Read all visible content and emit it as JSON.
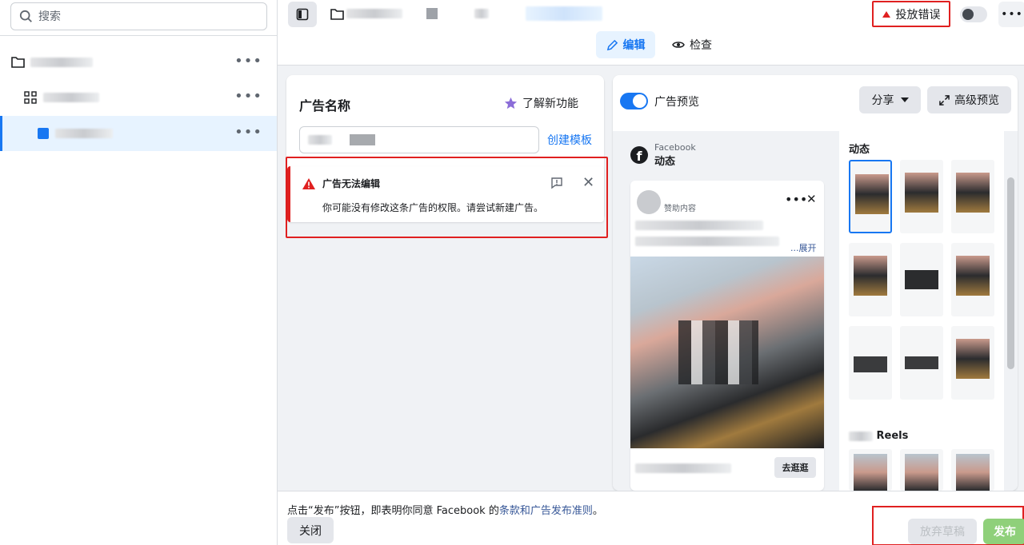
{
  "sidebar": {
    "search_placeholder": "搜索",
    "items": [
      {
        "type": "campaign"
      },
      {
        "type": "adset"
      },
      {
        "type": "ad",
        "selected": true
      }
    ]
  },
  "toolbar": {
    "error_label": "投放错误",
    "tab_edit": "编辑",
    "tab_check": "检查"
  },
  "editor": {
    "ad_name_label": "广告名称",
    "learn_features": "了解新功能",
    "create_template": "创建模板",
    "error_title": "广告无法编辑",
    "error_message": "你可能没有修改这条广告的权限。请尝试新建广告。"
  },
  "preview": {
    "toggle_label": "广告预览",
    "share_label": "分享",
    "advanced_label": "高级预览",
    "platform": "Facebook",
    "placement": "动态",
    "sponsored": "赞助内容",
    "expand": "...展开",
    "cta": "去逛逛",
    "section_feed": "动态",
    "section_reels_suffix": "Reels"
  },
  "footer": {
    "legal_prefix": "点击“发布”按钮，即表明你同意 Facebook 的",
    "legal_link": "条款和广告发布准则",
    "legal_suffix": "。",
    "close_label": "关闭",
    "discard_label": "放弃草稿",
    "publish_label": "发布"
  },
  "colors": {
    "accent": "#1877f2",
    "error": "#e02020",
    "publish_disabled": "#8fd07a"
  }
}
